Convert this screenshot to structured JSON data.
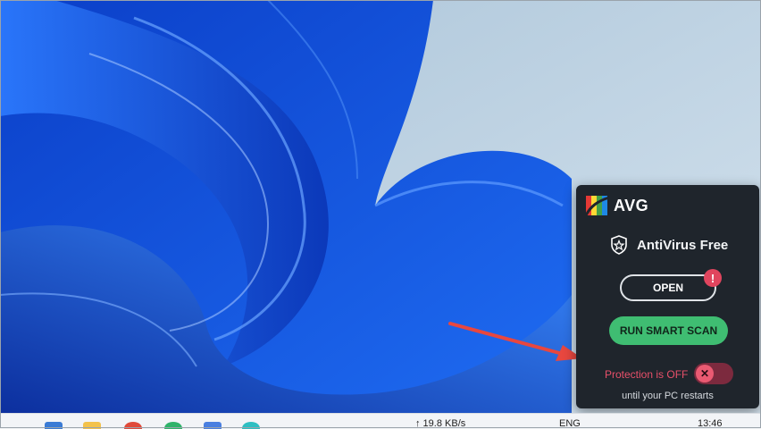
{
  "popup": {
    "brand": "AVG",
    "product_name": "AntiVirus Free",
    "open_label": "OPEN",
    "alert_badge": "!",
    "scan_label": "RUN SMART SCAN",
    "protection_status": "Protection is OFF",
    "toggle_symbol": "✕",
    "restart_note": "until your PC restarts"
  },
  "taskbar": {
    "network_speed": "↑ 19.8 KB/s",
    "language": "ENG",
    "clock": "13:46"
  },
  "icons": {
    "logo": "avg-logo-icon",
    "shield": "shield-star-icon",
    "arrow": "red-arrow-annotation-icon"
  },
  "colors": {
    "popup_bg": "#1f252c",
    "scan_button": "#3fbd72",
    "alert": "#e0455e",
    "protection_off": "#e8506a",
    "arrow": "#e8473f"
  }
}
